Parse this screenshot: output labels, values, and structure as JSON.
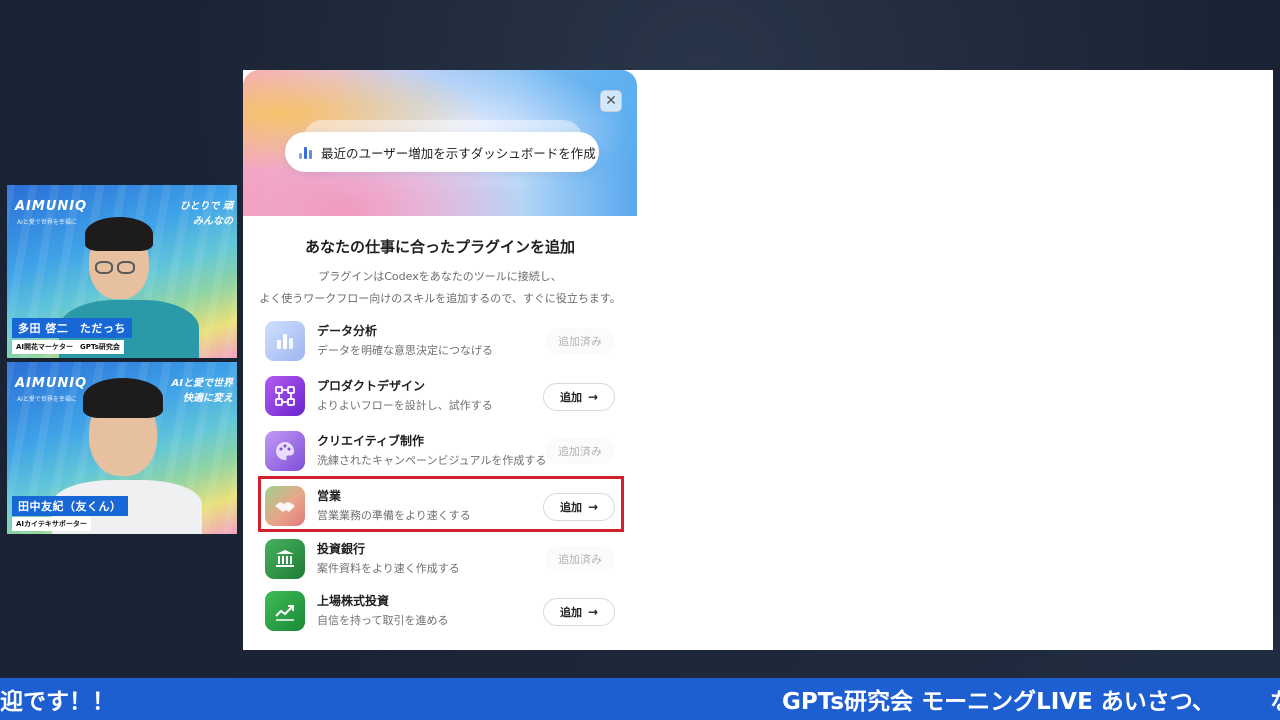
{
  "dialog": {
    "close_icon": "close-icon",
    "prompt_text": "最近のユーザー増加を示すダッシュボードを作成",
    "title": "あなたの仕事に合ったプラグインを追加",
    "desc_line1": "プラグインはCodexをあなたのツールに接続し、",
    "desc_line2": "よく使うワークフロー向けのスキルを追加するので、すぐに役立ちます。",
    "plugins": [
      {
        "name": "データ分析",
        "desc": "データを明確な意思決定につなげる",
        "status": "added",
        "label": "追加済み",
        "icon": "bar-chart-icon",
        "color": "#b6c6f2"
      },
      {
        "name": "プロダクトデザイン",
        "desc": "よりよいフローを設計し、試作する",
        "status": "add",
        "label": "追加",
        "icon": "flow-design-icon",
        "color": "#8a3ee0"
      },
      {
        "name": "クリエイティブ制作",
        "desc": "洗練されたキャンペーンビジュアルを作成する",
        "status": "added",
        "label": "追加済み",
        "icon": "palette-icon",
        "color": "#a67bea"
      },
      {
        "name": "営業",
        "desc": "営業業務の準備をより速くする",
        "status": "add",
        "label": "追加",
        "icon": "handshake-icon",
        "color": "#e8a08a"
      },
      {
        "name": "投資銀行",
        "desc": "案件資料をより速く作成する",
        "status": "added",
        "label": "追加済み",
        "icon": "bank-icon",
        "color": "#2f9a4a"
      },
      {
        "name": "上場株式投資",
        "desc": "自信を持って取引を進める",
        "status": "add",
        "label": "追加",
        "icon": "stock-chart-icon",
        "color": "#2a9e45"
      }
    ]
  },
  "presenters": [
    {
      "logo": "AIMUNIQ",
      "sub": "AIと愛で世界を幸福に",
      "tag_line1": "ひとりで 頑",
      "tag_line2": "みんなの",
      "name": "多田 啓二　ただっち",
      "title": "AI開花マーケター　GPTs研究会"
    },
    {
      "logo": "AIMUNIQ",
      "sub": "AIと愛で世界を幸福に",
      "tag_line1": "AIと愛で世界",
      "tag_line2": "快適に変え",
      "name": "田中友紀（友くん）",
      "title": "AIカイテキサポーター"
    }
  ],
  "ticker": {
    "left_text": "迎です！！",
    "right_text": "GPTs研究会 モーニングLIVE あいさつ、",
    "trailing_char": "な"
  }
}
